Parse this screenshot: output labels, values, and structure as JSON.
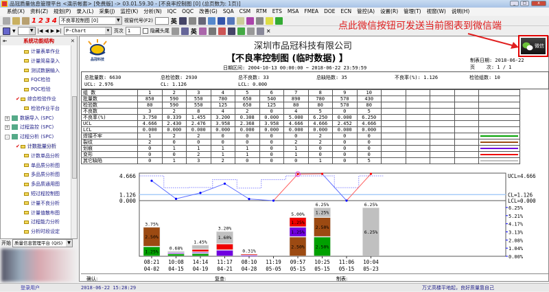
{
  "window": {
    "title": "品冠质量信息管理平台 <演示帐套> [免费版] -> 03.01.59.30 - [不良率控制图 [0] (总页数为: 1页)]"
  },
  "menu": [
    "系统(X)",
    "资料(Z)",
    "规划(P)",
    "录入(L)",
    "采集(J)",
    "监控(K)",
    "分析(N)",
    "IQC",
    "OQC",
    "改善(G)",
    "SQA",
    "CSM",
    "RTM",
    "ETS",
    "MSA",
    "FMEA",
    "DOE",
    "ECN",
    "管控(A)",
    "设置(R)",
    "管理(T)",
    "视窗(W)",
    "说明(H)"
  ],
  "toolbar1": {
    "numbers": [
      "1",
      "2",
      "3",
      "4"
    ],
    "form_combo": "不良率控制图 [0]",
    "window_code_label": "视窗代号(F2)",
    "window_code_value": "",
    "lang_btn": "英"
  },
  "toolbar2": {
    "chart_combo": "P-Chart",
    "page_label": "页次",
    "page_value": "1",
    "hide_label": "隐藏头尾",
    "lang_btn": "英",
    "close": "✕"
  },
  "annotation": "点此微信按钮可发送当前图表到微信端",
  "wechat_button": "微信",
  "sidebar": {
    "title": "系统功能结构",
    "items": [
      {
        "label": "计量表单作业",
        "level": 2
      },
      {
        "label": "计量简易录入",
        "level": 2
      },
      {
        "label": "测试数据输入",
        "level": 2
      },
      {
        "label": "FQC检验",
        "level": 2
      },
      {
        "label": "PQC检验",
        "level": 2
      },
      {
        "label": "综合检验作业",
        "level": 2,
        "checked": true
      },
      {
        "label": "检验作业平台",
        "level": 2
      },
      {
        "label": "数据导入 (SPC)",
        "level": 1,
        "expander": "+"
      },
      {
        "label": "过程监控 (SPC)",
        "level": 1,
        "expander": "+"
      },
      {
        "label": "过程分析 (SPC)",
        "level": 1,
        "expander": "-"
      },
      {
        "label": "计数批量分析",
        "level": 2,
        "checked": true,
        "selected": true
      },
      {
        "label": "计数单品分析",
        "level": 2
      },
      {
        "label": "单品质分析图",
        "level": 2
      },
      {
        "label": "多品质分析图",
        "level": 2
      },
      {
        "label": "多品质通用图",
        "level": 2
      },
      {
        "label": "短过程控制图",
        "level": 2
      },
      {
        "label": "计量不良分析",
        "level": 2
      },
      {
        "label": "计量值散布图",
        "level": 2
      },
      {
        "label": "过程能力分析",
        "level": 2
      },
      {
        "label": "分析时段设定",
        "level": 2
      }
    ],
    "start_label": "开始",
    "start_combo": "质量信息管理平台 (QIS)"
  },
  "report": {
    "logo_text": "品冠科技",
    "company": "深圳市品冠科技有限公司",
    "title": "【不良率控制图 (临时数据) 】",
    "date_range": "日期区间: 2004-10-13 00:00:00 ~ 2018-06-22 23:59:59",
    "made_date": "制表日期: 2018-06-22",
    "page_info": "页    次: 1 / 1",
    "summary": {
      "total_batch": "总批量数: 6630",
      "total_inspected": "总检验数: 2930",
      "total_defective": "总不良数: 33",
      "total_defects": "总缺陷数: 35",
      "defect_rate": "不良率(%): 1.126",
      "groups": "检验组数: 10",
      "ucl": "UCL: 2.976",
      "cl": "CL: 1.126",
      "lcl": "LCL: 0.000"
    },
    "footer": {
      "confirm": "确认:",
      "review": "复查:",
      "made": "制表:"
    }
  },
  "table": {
    "header": "组  数",
    "groups": [
      "1",
      "2",
      "3",
      "4",
      "5",
      "6",
      "7",
      "8",
      "9",
      "10"
    ],
    "rows": [
      {
        "label": "批量数",
        "values": [
          "850",
          "590",
          "550",
          "780",
          "650",
          "540",
          "890",
          "780",
          "570",
          "430"
        ]
      },
      {
        "label": "检验数",
        "values": [
          "80",
          "590",
          "550",
          "125",
          "650",
          "125",
          "80",
          "80",
          "570",
          "80"
        ]
      },
      {
        "label": "不良数",
        "values": [
          "3",
          "2",
          "8",
          "4",
          "2",
          "0",
          "4",
          "5",
          "0",
          "5"
        ]
      },
      {
        "label": "不良率(%)",
        "values": [
          "3.750",
          "0.339",
          "1.455",
          "3.200",
          "0.308",
          "0.000",
          "5.000",
          "6.250",
          "0.000",
          "6.250"
        ]
      },
      {
        "label": "UCL",
        "values": [
          "4.666",
          "2.430",
          "2.476",
          "3.958",
          "2.368",
          "3.958",
          "4.666",
          "4.666",
          "2.452",
          "4.666"
        ]
      },
      {
        "label": "LCL",
        "values": [
          "0.000",
          "0.000",
          "0.000",
          "0.000",
          "0.000",
          "0.000",
          "0.000",
          "0.000",
          "0.000",
          "0.000"
        ]
      }
    ],
    "defects": [
      {
        "label": "焊接不牢",
        "color": "#00a000",
        "values": [
          1,
          2,
          2,
          0,
          0,
          0,
          0,
          2,
          0,
          0
        ]
      },
      {
        "label": "裂纹",
        "color": "#9c4a12",
        "values": [
          2,
          0,
          0,
          0,
          0,
          0,
          2,
          2,
          0,
          0
        ]
      },
      {
        "label": "划痕",
        "color": "#7000e0",
        "values": [
          0,
          1,
          1,
          1,
          1,
          0,
          1,
          0,
          0,
          0
        ]
      },
      {
        "label": "变形",
        "color": "#f00000",
        "values": [
          0,
          0,
          2,
          1,
          1,
          0,
          1,
          0,
          0,
          0
        ]
      },
      {
        "label": "其它缺陷",
        "color": "#c0c0c0",
        "values": [
          0,
          1,
          3,
          2,
          0,
          0,
          0,
          1,
          0,
          5
        ]
      }
    ]
  },
  "chart_data": {
    "type": "bar",
    "title": "P-Chart",
    "x": [
      [
        "08:21",
        "04-02"
      ],
      [
        "10:08",
        "04-15"
      ],
      [
        "14:14",
        "04-19"
      ],
      [
        "11:17",
        "04-21"
      ],
      [
        "08:10",
        "04-28"
      ],
      [
        "11:19",
        "05-05"
      ],
      [
        "09:57",
        "05-15"
      ],
      [
        "10:25",
        "05-15"
      ],
      [
        "11:06",
        "05-15"
      ],
      [
        "10:04",
        "05-23"
      ]
    ],
    "p": [
      3.75,
      0.339,
      1.455,
      3.2,
      0.308,
      0,
      5,
      6.25,
      0,
      6.25
    ],
    "ucl": [
      4.666,
      2.43,
      2.476,
      3.958,
      2.368,
      3.958,
      4.666,
      4.666,
      2.452,
      4.666
    ],
    "cl": 1.126,
    "lcl": 0,
    "inspected": [
      80,
      590,
      550,
      125,
      650,
      125,
      80,
      80,
      570,
      80
    ],
    "total_labels": [
      "3.75%",
      "0.68%",
      "1.45%",
      "3.20%",
      "0.31%",
      "",
      "5.00%",
      "6.25%",
      "",
      "6.25%"
    ],
    "left_ticks": [
      "4.666",
      "1.126",
      "0.000"
    ],
    "right_labels": [
      "UCL=4.666",
      "CL=1.126",
      "LCL=0.000"
    ],
    "right_ticks": [
      "6.25%",
      "5.21%",
      "4.17%",
      "3.13%",
      "2.08%",
      "1.04%",
      "0.00%"
    ],
    "ylim_bar": [
      0,
      6.25
    ],
    "colors": {
      "point": "#0000ff",
      "out": "#ff0000",
      "cl": "#a8ccf8",
      "ucl": "#8080ff"
    }
  },
  "status": {
    "user": "登录用户",
    "datetime": "2018-06-22 15:28:29",
    "motto": "万丈高楼平地起，良好质量靠自己"
  }
}
